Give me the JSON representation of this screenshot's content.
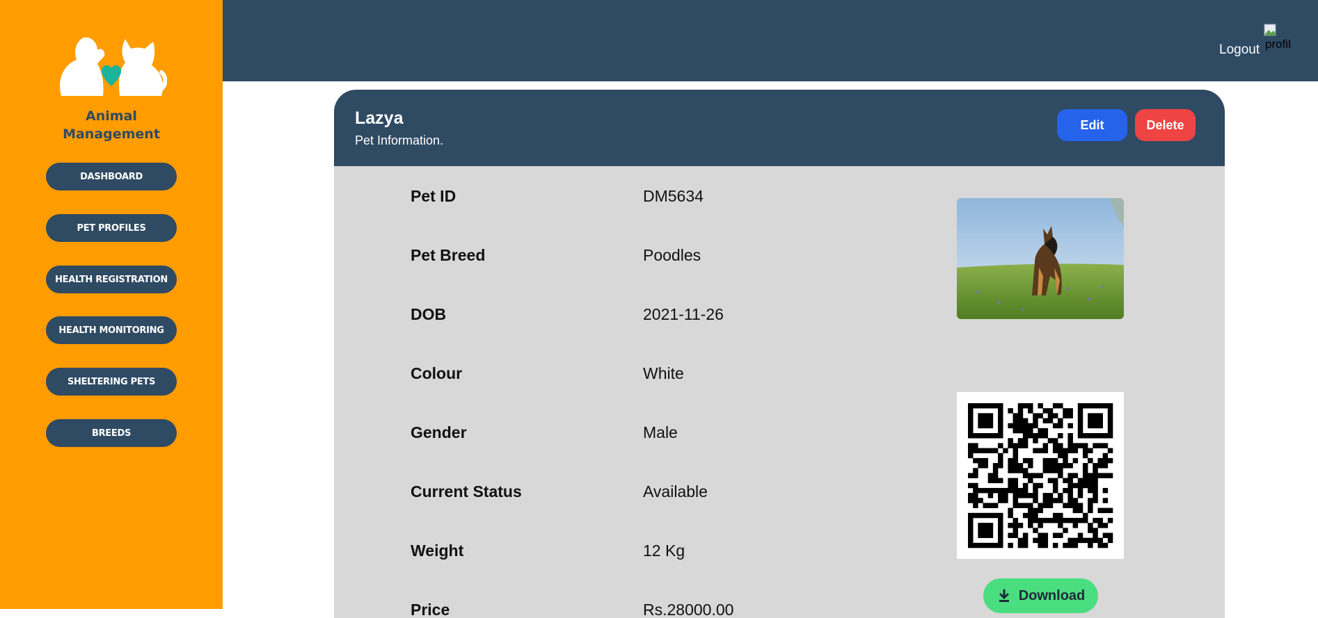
{
  "sidebar": {
    "brand_line1": "Animal",
    "brand_line2": "Management",
    "items": [
      {
        "label": "DASHBOARD"
      },
      {
        "label": "PET PROFILES"
      },
      {
        "label": "HEALTH REGISTRATION"
      },
      {
        "label": "HEALTH MONITORING"
      },
      {
        "label": "SHELTERING PETS"
      },
      {
        "label": "BREEDS"
      }
    ]
  },
  "header": {
    "logout_label": "Logout",
    "avatar_alt": "profile"
  },
  "pet": {
    "name": "Lazya",
    "subtitle": "Pet Information.",
    "edit_label": "Edit",
    "delete_label": "Delete",
    "download_label": "Download",
    "fields": [
      {
        "label": "Pet ID",
        "value": "DM5634"
      },
      {
        "label": "Pet Breed",
        "value": "Poodles"
      },
      {
        "label": "DOB",
        "value": "2021-11-26"
      },
      {
        "label": "Colour",
        "value": "White"
      },
      {
        "label": "Gender",
        "value": "Male"
      },
      {
        "label": "Current Status",
        "value": "Available"
      },
      {
        "label": "Weight",
        "value": "12 Kg"
      },
      {
        "label": "Price",
        "value": "Rs.28000.00"
      }
    ]
  },
  "colors": {
    "sidebar_bg": "#ff9c00",
    "navy": "#2f4a63",
    "edit": "#2563eb",
    "delete": "#ef4444",
    "download": "#4ade80",
    "card_bg": "#d8d8d8"
  },
  "icons": {
    "logo": "cat-dog-heart-logo",
    "download": "download-icon"
  }
}
